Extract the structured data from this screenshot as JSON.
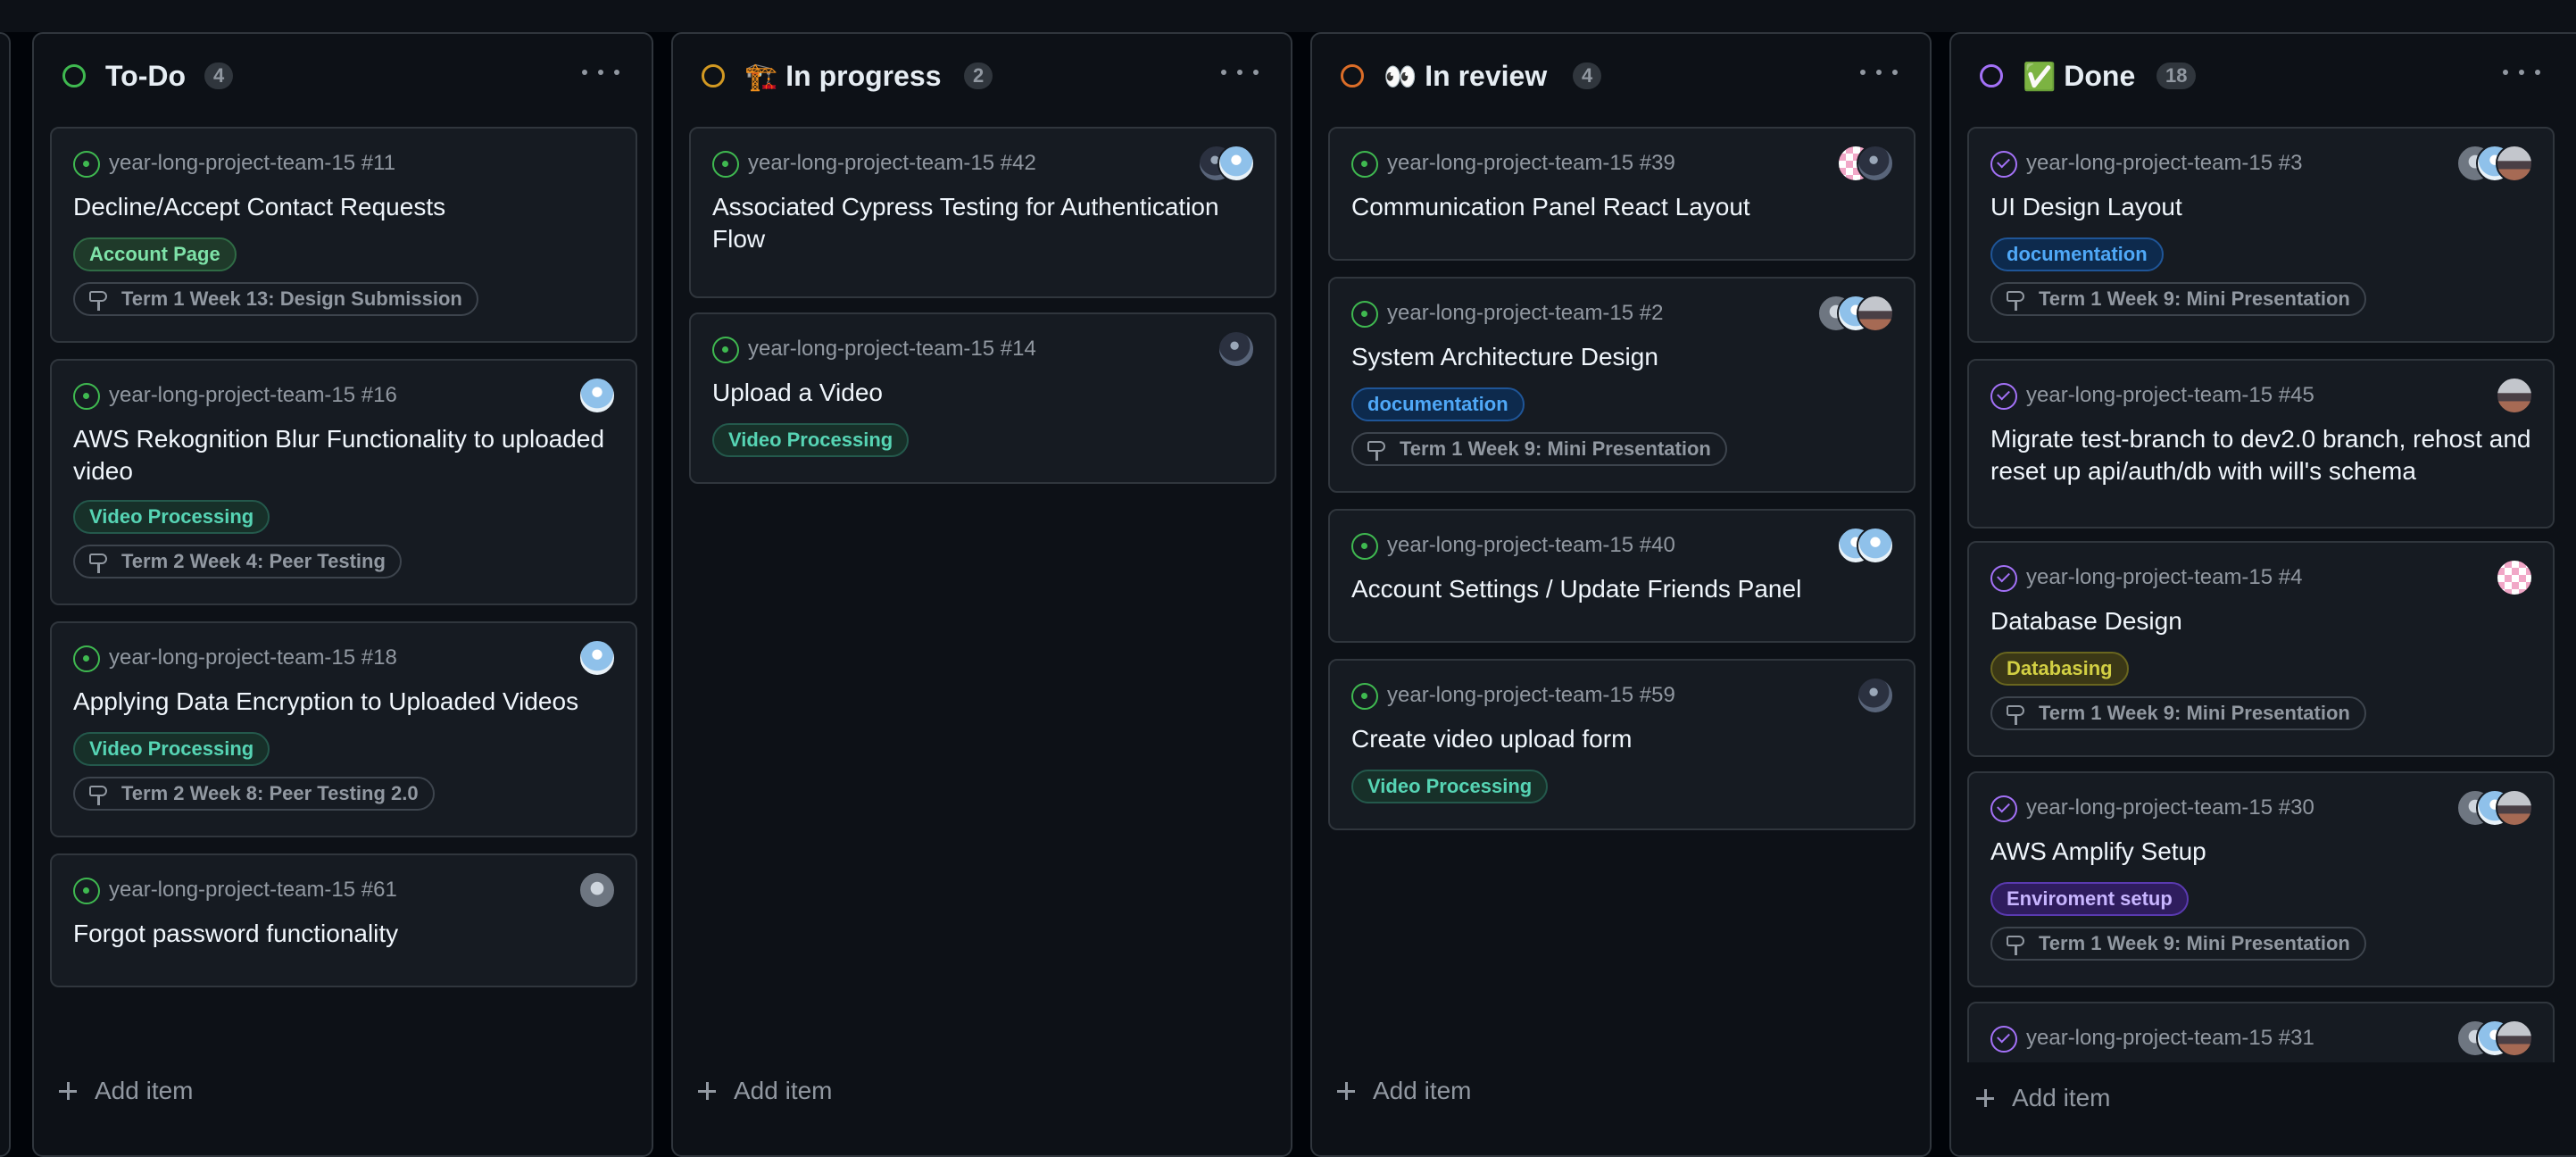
{
  "colors": {
    "todo": "#3fb950",
    "in_progress": "#d29922",
    "in_review": "#db6d28",
    "done": "#a371f7"
  },
  "columns": [
    {
      "title": "To-Do",
      "emoji": "",
      "count": "4",
      "cards": [
        {
          "ref": "year-long-project-team-15 #11",
          "title": "Decline/Accept Contact Requests",
          "label": "Account Page",
          "milestone": "Term 1 Week 13: Design Submission",
          "state": "open",
          "avatars": []
        },
        {
          "ref": "year-long-project-team-15 #16",
          "title": "AWS Rekognition Blur Functionality to uploaded video",
          "label": "Video Processing",
          "milestone": "Term 2 Week 4: Peer Testing",
          "state": "open",
          "avatars": [
            "blue"
          ]
        },
        {
          "ref": "year-long-project-team-15 #18",
          "title": "Applying Data Encryption to Uploaded Videos",
          "label": "Video Processing",
          "milestone": "Term 2 Week 8: Peer Testing 2.0",
          "state": "open",
          "avatars": [
            "blue"
          ]
        },
        {
          "ref": "year-long-project-team-15 #61",
          "title": "Forgot password functionality",
          "label": "",
          "milestone": "",
          "state": "open",
          "avatars": [
            "grey"
          ]
        }
      ],
      "add_label": "Add item"
    },
    {
      "title": "In progress",
      "emoji": "🏗️",
      "count": "2",
      "cards": [
        {
          "ref": "year-long-project-team-15 #42",
          "title": "Associated Cypress Testing for Authentication Flow",
          "label": "",
          "milestone": "",
          "state": "open",
          "avatars": [
            "dark",
            "blue"
          ]
        },
        {
          "ref": "year-long-project-team-15 #14",
          "title": "Upload a Video",
          "label": "Video Processing",
          "milestone": "",
          "state": "open",
          "avatars": [
            "dark"
          ]
        }
      ],
      "add_label": "Add item"
    },
    {
      "title": "In review",
      "emoji": "👀",
      "count": "4",
      "cards": [
        {
          "ref": "year-long-project-team-15 #39",
          "title": "Communication Panel React Layout",
          "label": "",
          "milestone": "",
          "state": "open",
          "avatars": [
            "pink",
            "dark"
          ]
        },
        {
          "ref": "year-long-project-team-15 #2",
          "title": "System Architecture Design",
          "label": "documentation",
          "milestone": "Term 1 Week 9: Mini Presentation",
          "state": "open",
          "avatars": [
            "grey",
            "blue",
            "photo"
          ]
        },
        {
          "ref": "year-long-project-team-15 #40",
          "title": "Account Settings / Update Friends Panel",
          "label": "",
          "milestone": "",
          "state": "open",
          "avatars": [
            "blue",
            "blue"
          ]
        },
        {
          "ref": "year-long-project-team-15 #59",
          "title": "Create video upload form",
          "label": "Video Processing",
          "milestone": "",
          "state": "open",
          "avatars": [
            "dark"
          ]
        }
      ],
      "add_label": "Add item"
    },
    {
      "title": "Done",
      "emoji": "✅",
      "count": "18",
      "cards": [
        {
          "ref": "year-long-project-team-15 #3",
          "title": "UI Design Layout",
          "label": "documentation",
          "milestone": "Term 1 Week 9: Mini Presentation",
          "state": "closed",
          "avatars": [
            "grey",
            "blue",
            "photo"
          ]
        },
        {
          "ref": "year-long-project-team-15 #45",
          "title": "Migrate test-branch to dev2.0 branch, rehost and reset up api/auth/db with will's schema",
          "label": "",
          "milestone": "",
          "state": "closed",
          "avatars": [
            "photo"
          ]
        },
        {
          "ref": "year-long-project-team-15 #4",
          "title": "Database Design",
          "label": "Databasing",
          "milestone": "Term 1 Week 9: Mini Presentation",
          "state": "closed",
          "avatars": [
            "pink"
          ]
        },
        {
          "ref": "year-long-project-team-15 #30",
          "title": "AWS Amplify Setup",
          "label": "Enviroment setup",
          "milestone": "Term 1 Week 9: Mini Presentation",
          "state": "closed",
          "avatars": [
            "grey",
            "blue",
            "photo"
          ]
        },
        {
          "ref": "year-long-project-team-15 #31",
          "title": "",
          "label": "",
          "milestone": "",
          "state": "closed",
          "avatars": [
            "grey",
            "blue",
            "photo"
          ]
        }
      ],
      "add_label": "Add item"
    }
  ]
}
